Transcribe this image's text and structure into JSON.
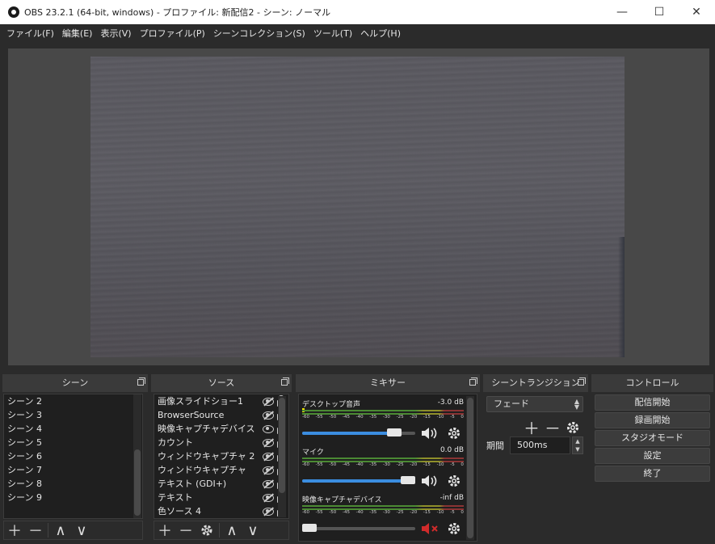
{
  "window": {
    "title": "OBS 23.2.1 (64-bit, windows) - プロファイル: 新配信2 - シーン: ノーマル",
    "minimize": "—",
    "maximize": "☐",
    "close": "✕"
  },
  "menu": [
    "ファイル(F)",
    "編集(E)",
    "表示(V)",
    "プロファイル(P)",
    "シーンコレクション(S)",
    "ツール(T)",
    "ヘルプ(H)"
  ],
  "docks": {
    "scenes": {
      "title": "シーン"
    },
    "sources": {
      "title": "ソース"
    },
    "mixer": {
      "title": "ミキサー"
    },
    "transitions": {
      "title": "シーントランジション"
    },
    "controls": {
      "title": "コントロール"
    }
  },
  "scenes": [
    "シーン 2",
    "シーン 3",
    "シーン 4",
    "シーン 5",
    "シーン 6",
    "シーン 7",
    "シーン 8",
    "シーン 9"
  ],
  "sources": [
    {
      "name": "画像スライドショー1",
      "visible": false
    },
    {
      "name": "BrowserSource",
      "visible": false
    },
    {
      "name": "映像キャプチャデバイス",
      "visible": true
    },
    {
      "name": "カウント",
      "visible": false
    },
    {
      "name": "ウィンドウキャプチャ 2",
      "visible": false
    },
    {
      "name": "ウィンドウキャプチャ",
      "visible": false
    },
    {
      "name": "テキスト (GDI+)",
      "visible": false
    },
    {
      "name": "テキスト",
      "visible": false
    },
    {
      "name": "色ソース 4",
      "visible": false
    }
  ],
  "mixer": {
    "scale": [
      "-60",
      "-55",
      "-50",
      "-45",
      "-40",
      "-35",
      "-30",
      "-25",
      "-20",
      "-15",
      "-10",
      "-5",
      "0"
    ],
    "channels": [
      {
        "name": "デスクトップ音声",
        "db": "-3.0 dB",
        "volume": 0.88,
        "muted": false
      },
      {
        "name": "マイク",
        "db": "0.0 dB",
        "volume": 1.0,
        "muted": false
      },
      {
        "name": "映像キャプチャデバイス",
        "db": "-inf dB",
        "volume": 0.0,
        "muted": true
      }
    ]
  },
  "transitions": {
    "selected": "フェード",
    "duration_label": "期間",
    "duration_value": "500ms"
  },
  "controls": [
    "配信開始",
    "録画開始",
    "スタジオモード",
    "設定",
    "終了"
  ],
  "colors": {
    "background": "#2b2b2b",
    "accent": "#3b8de0",
    "mute": "#d12b2b"
  }
}
